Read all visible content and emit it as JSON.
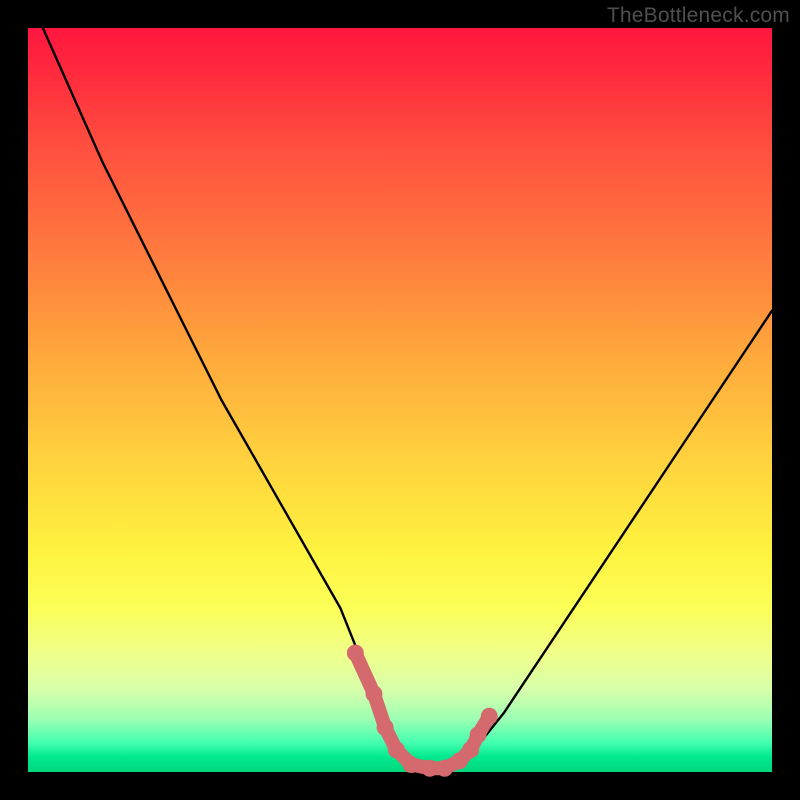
{
  "watermark": "TheBottleneck.com",
  "colors": {
    "curve_stroke": "#000000",
    "marker_stroke": "#d46a6e",
    "marker_fill": "#d46a6e",
    "gradient_top": "#ff163f",
    "gradient_bottom": "#00d77e",
    "frame": "#000000"
  },
  "chart_data": {
    "type": "line",
    "title": "",
    "xlabel": "",
    "ylabel": "",
    "xlim": [
      0,
      100
    ],
    "ylim": [
      0,
      100
    ],
    "annotations": [],
    "series": [
      {
        "name": "bottleneck-curve",
        "x": [
          2,
          6,
          10,
          14,
          18,
          22,
          26,
          30,
          34,
          38,
          42,
          44,
          46,
          48,
          50,
          52,
          54,
          56,
          58,
          60,
          64,
          68,
          72,
          76,
          80,
          84,
          88,
          92,
          96,
          100
        ],
        "y": [
          100,
          91,
          82,
          74,
          66,
          58,
          50,
          43,
          36,
          29,
          22,
          17,
          12,
          7,
          3,
          1,
          0,
          0,
          1,
          3,
          8,
          14,
          20,
          26,
          32,
          38,
          44,
          50,
          56,
          62
        ]
      }
    ],
    "markers": {
      "name": "valley-highlight",
      "x": [
        44.0,
        46.5,
        48.0,
        49.5,
        51.5,
        54.0,
        56.0,
        58.0,
        59.5,
        60.5,
        62.0
      ],
      "y": [
        16.0,
        10.5,
        6.0,
        3.0,
        1.0,
        0.5,
        0.5,
        1.5,
        3.0,
        5.0,
        7.5
      ]
    }
  }
}
